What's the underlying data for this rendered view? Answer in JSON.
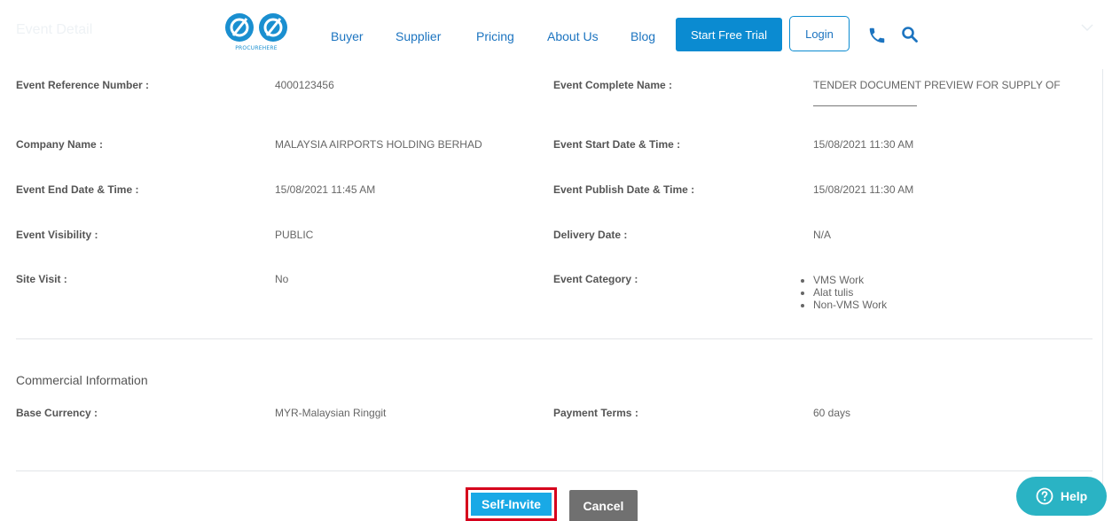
{
  "header_ghost": {
    "title": "Event Detail"
  },
  "nav": {
    "logo_text": "PROCUREHERE",
    "links": [
      "Buyer",
      "Supplier",
      "Pricing",
      "About Us",
      "Blog"
    ],
    "trial_label": "Start Free Trial",
    "login_label": "Login"
  },
  "details": {
    "ref_label": "Event Reference Number :",
    "ref_value": "4000123456",
    "name_label": "Event Complete Name :",
    "name_value": "TENDER DOCUMENT PREVIEW FOR SUPPLY OF",
    "company_label": "Company Name :",
    "company_value": "MALAYSIA AIRPORTS HOLDING BERHAD",
    "start_label": "Event Start Date & Time :",
    "start_value": "15/08/2021 11:30 AM",
    "end_label": "Event End Date & Time :",
    "end_value": "15/08/2021 11:45 AM",
    "publish_label": "Event Publish Date & Time :",
    "publish_value": "15/08/2021 11:30 AM",
    "visibility_label": "Event Visibility :",
    "visibility_value": "PUBLIC",
    "delivery_label": "Delivery Date :",
    "delivery_value": "N/A",
    "site_label": "Site Visit :",
    "site_value": "No",
    "category_label": "Event Category :",
    "categories": [
      "VMS Work",
      "Alat tulis",
      "Non-VMS Work"
    ]
  },
  "commercial": {
    "title": "Commercial Information",
    "currency_label": "Base Currency :",
    "currency_value": "MYR-Malaysian Ringgit",
    "payment_label": "Payment Terms :",
    "payment_value": "60 days"
  },
  "actions": {
    "self_invite_label": "Self-Invite",
    "cancel_label": "Cancel",
    "help_label": "Help"
  },
  "colors": {
    "brand_blue": "#0b8bd1",
    "self_invite": "#19a9e6",
    "highlight": "#d6001c",
    "help": "#2ab3c4"
  }
}
